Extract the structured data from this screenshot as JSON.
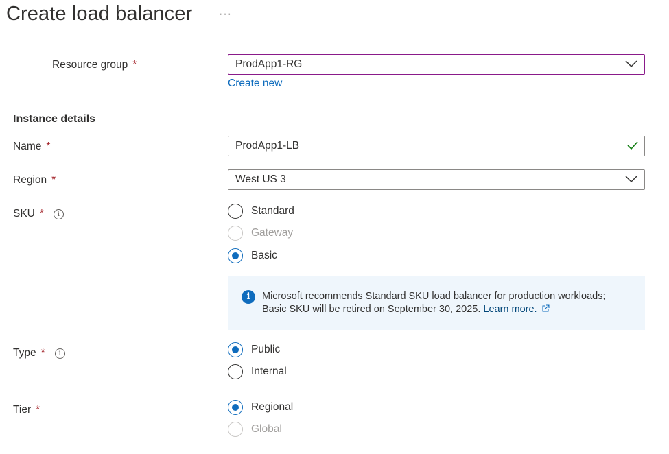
{
  "page": {
    "title": "Create load balancer",
    "more_label": "···"
  },
  "resource_group": {
    "label": "Resource group",
    "required_mark": "*",
    "value": "ProdApp1-RG",
    "create_new_label": "Create new"
  },
  "instance_details": {
    "heading": "Instance details",
    "name": {
      "label": "Name",
      "required_mark": "*",
      "value": "ProdApp1-LB"
    },
    "region": {
      "label": "Region",
      "required_mark": "*",
      "value": "West US 3"
    },
    "sku": {
      "label": "SKU",
      "required_mark": "*",
      "info_glyph": "i",
      "options": [
        {
          "label": "Standard",
          "state": "unchecked"
        },
        {
          "label": "Gateway",
          "state": "disabled"
        },
        {
          "label": "Basic",
          "state": "checked"
        }
      ],
      "notice": {
        "icon": "info-icon",
        "line1": "Microsoft recommends Standard SKU load balancer for production workloads;",
        "line2": "Basic SKU will be retired on September 30, 2025.",
        "link": "Learn more."
      }
    },
    "type": {
      "label": "Type",
      "required_mark": "*",
      "info_glyph": "i",
      "options": [
        {
          "label": "Public",
          "state": "checked"
        },
        {
          "label": "Internal",
          "state": "unchecked"
        }
      ]
    },
    "tier": {
      "label": "Tier",
      "required_mark": "*",
      "options": [
        {
          "label": "Regional",
          "state": "checked"
        },
        {
          "label": "Global",
          "state": "disabled"
        }
      ]
    }
  },
  "colors": {
    "accent": "#0f6cbd",
    "required": "#a4262c",
    "focus_border": "#8a1a8a",
    "valid_check": "#107c10",
    "notice_bg": "#eff6fc"
  }
}
